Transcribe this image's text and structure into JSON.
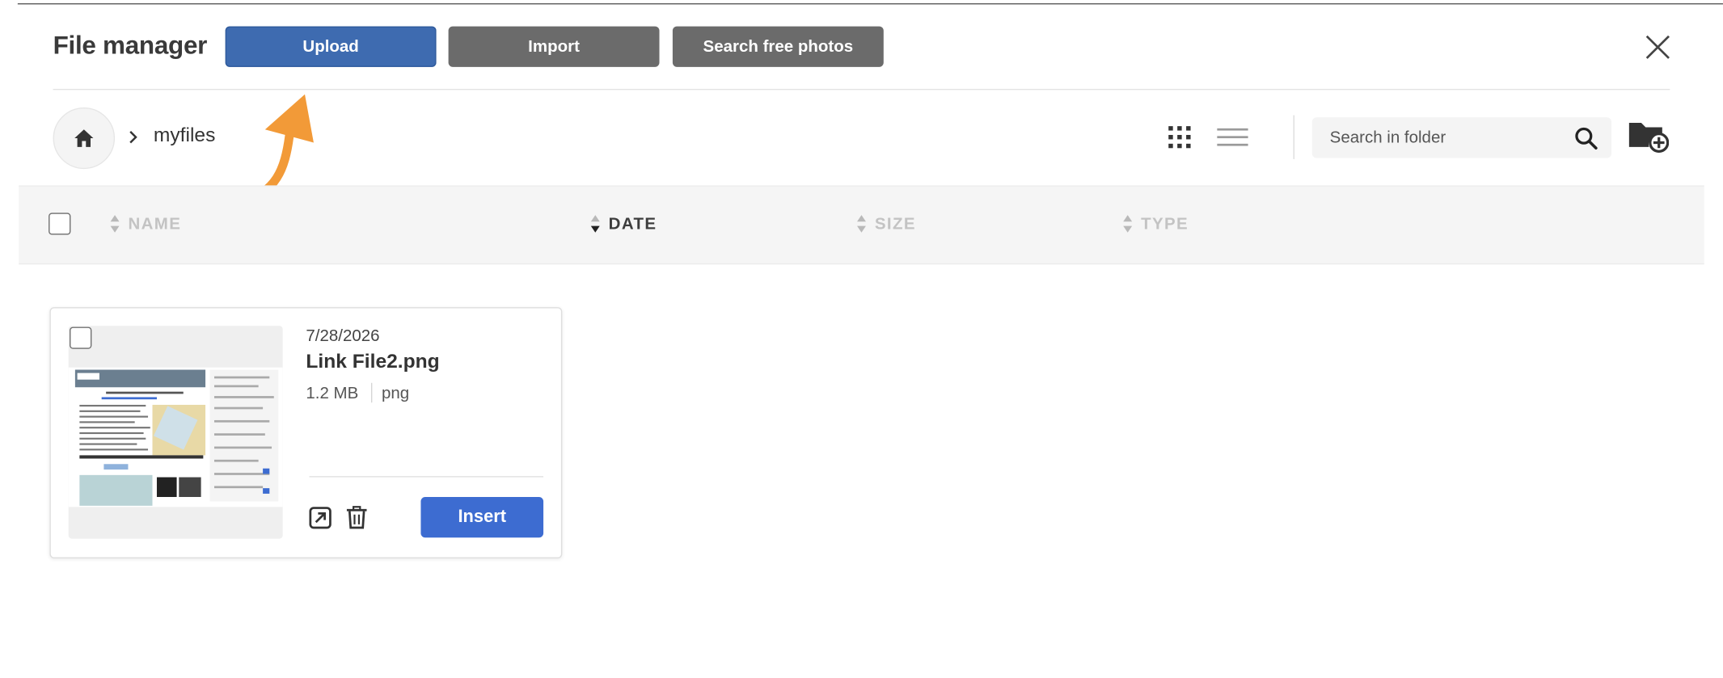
{
  "header": {
    "title": "File manager",
    "upload_label": "Upload",
    "import_label": "Import",
    "search_photos_label": "Search free photos"
  },
  "breadcrumb": {
    "home_icon": "home-icon",
    "separator_icon": "chevron-right-icon",
    "items": [
      "myfiles"
    ]
  },
  "toolbar": {
    "grid_view_icon": "grid-view-icon",
    "list_view_icon": "list-view-icon",
    "search_placeholder": "Search in folder",
    "search_value": "",
    "search_icon": "search-icon",
    "new_folder_icon": "new-folder-icon"
  },
  "table": {
    "columns": [
      {
        "label": "NAME",
        "active": false
      },
      {
        "label": "DATE",
        "active": true,
        "sort": "desc"
      },
      {
        "label": "SIZE",
        "active": false
      },
      {
        "label": "TYPE",
        "active": false
      }
    ]
  },
  "files": [
    {
      "date": "7/28/2026",
      "name": "Link File2.png",
      "size": "1.2 MB",
      "type": "png",
      "insert_label": "Insert",
      "selected": false
    }
  ],
  "annotation": {
    "icon": "pointer-arrow-icon",
    "color": "#f29a38"
  },
  "colors": {
    "upload": "#3e6bb0",
    "secondary": "#6b6b6b",
    "insert": "#3d6cd1"
  }
}
